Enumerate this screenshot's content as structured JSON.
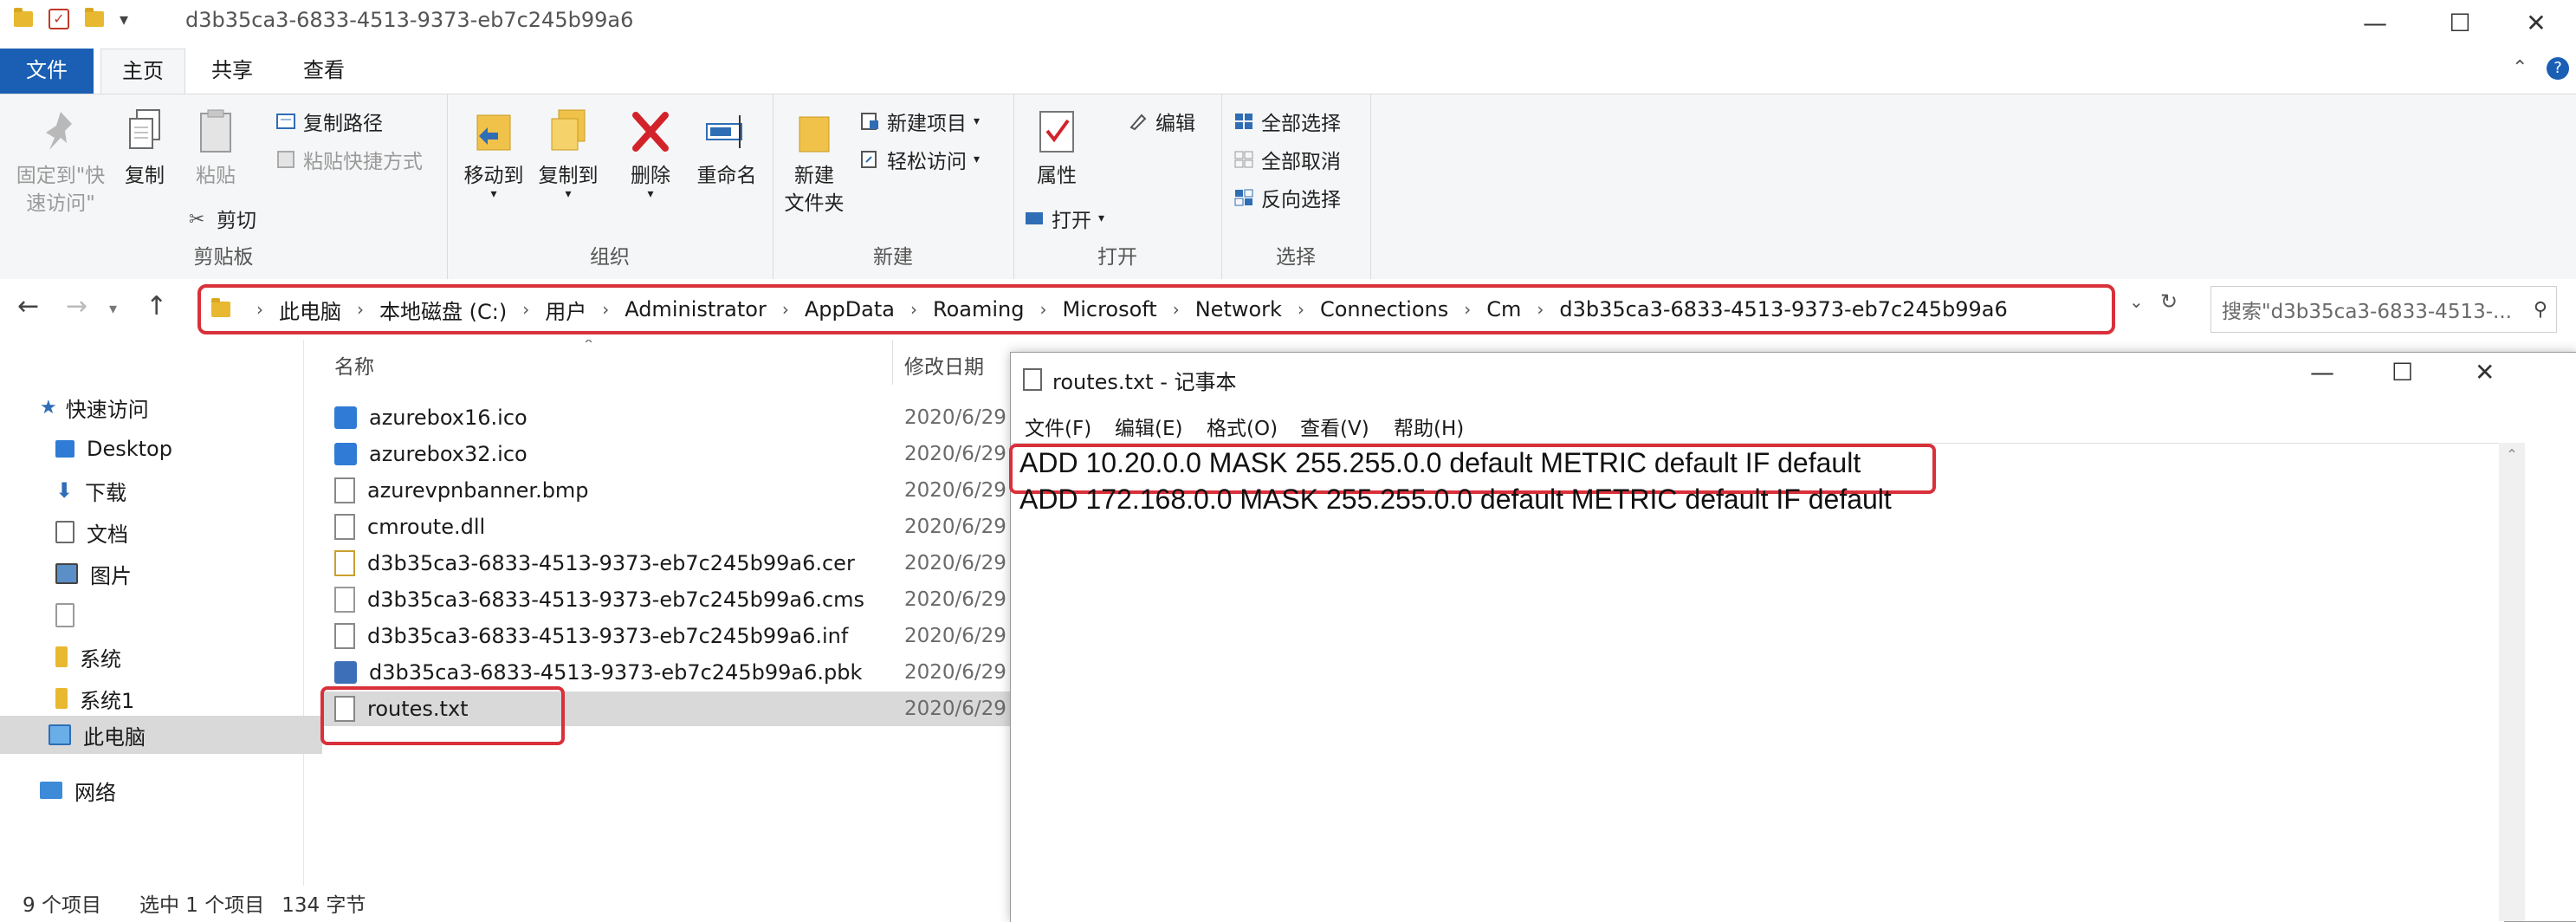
{
  "window": {
    "title": "d3b35ca3-6833-4513-9373-eb7c245b99a6",
    "minimize": "—",
    "maximize": "☐",
    "close": "✕"
  },
  "ribbon_tabs": {
    "file": "文件",
    "home": "主页",
    "share": "共享",
    "view": "查看"
  },
  "ribbon": {
    "clipboard": {
      "label": "剪贴板",
      "pin_line1": "固定到\"快",
      "pin_line2": "速访问\"",
      "copy": "复制",
      "paste": "粘贴",
      "copy_path": "复制路径",
      "paste_shortcut": "粘贴快捷方式",
      "cut": "剪切"
    },
    "organize": {
      "label": "组织",
      "move_to": "移动到",
      "copy_to": "复制到",
      "delete": "删除",
      "rename": "重命名"
    },
    "new": {
      "label": "新建",
      "new_folder_line1": "新建",
      "new_folder_line2": "文件夹",
      "new_item": "新建项目",
      "easy_access": "轻松访问"
    },
    "open": {
      "label": "打开",
      "properties": "属性",
      "open": "打开",
      "edit": "编辑"
    },
    "select": {
      "label": "选择",
      "select_all": "全部选择",
      "select_none": "全部取消",
      "invert": "反向选择"
    }
  },
  "address": {
    "crumbs": [
      "此电脑",
      "本地磁盘 (C:)",
      "用户",
      "Administrator",
      "AppData",
      "Roaming",
      "Microsoft",
      "Network",
      "Connections",
      "Cm",
      "d3b35ca3-6833-4513-9373-eb7c245b99a6"
    ],
    "search_placeholder": "搜索\"d3b35ca3-6833-4513-..."
  },
  "navpane": {
    "quick_access": "快速访问",
    "items": [
      "Desktop",
      "下载",
      "文档",
      "图片",
      "",
      "系统",
      "系统1"
    ],
    "this_pc": "此电脑",
    "network": "网络"
  },
  "filelist": {
    "col_name": "名称",
    "col_modified": "修改日期",
    "files": [
      {
        "name": "azurebox16.ico",
        "date": "2020/6/29"
      },
      {
        "name": "azurebox32.ico",
        "date": "2020/6/29"
      },
      {
        "name": "azurevpnbanner.bmp",
        "date": "2020/6/29"
      },
      {
        "name": "cmroute.dll",
        "date": "2020/6/29"
      },
      {
        "name": "d3b35ca3-6833-4513-9373-eb7c245b99a6.cer",
        "date": "2020/6/29"
      },
      {
        "name": "d3b35ca3-6833-4513-9373-eb7c245b99a6.cms",
        "date": "2020/6/29"
      },
      {
        "name": "d3b35ca3-6833-4513-9373-eb7c245b99a6.inf",
        "date": "2020/6/29"
      },
      {
        "name": "d3b35ca3-6833-4513-9373-eb7c245b99a6.pbk",
        "date": "2020/6/29"
      },
      {
        "name": "routes.txt",
        "date": "2020/6/29"
      }
    ]
  },
  "status": {
    "count": "9 个项目",
    "selected": "选中 1 个项目",
    "size": "134 字节"
  },
  "notepad": {
    "title": "routes.txt - 记事本",
    "menu": [
      "文件(F)",
      "编辑(E)",
      "格式(O)",
      "查看(V)",
      "帮助(H)"
    ],
    "lines": [
      "ADD 10.20.0.0 MASK 255.255.0.0 default METRIC default IF default",
      "ADD 172.168.0.0 MASK 255.255.0.0 default METRIC default IF default"
    ]
  },
  "colors": {
    "accent": "#1a5fb4",
    "highlight": "#d9303a",
    "folder": "#e8b830"
  }
}
